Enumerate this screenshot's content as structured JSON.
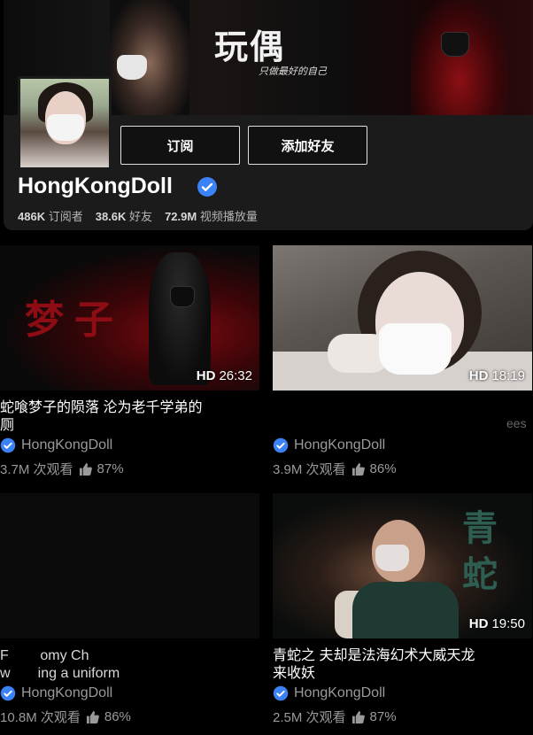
{
  "channel": {
    "banner_title": "玩偶",
    "banner_subtitle": "只做最好的自己",
    "name": "HongKongDoll",
    "subscribe_label": "订阅",
    "add_friend_label": "添加好友",
    "stats": [
      {
        "value": "486K",
        "label": "订阅者"
      },
      {
        "value": "38.6K",
        "label": "好友"
      },
      {
        "value": "72.9M",
        "label": "视频播放量"
      }
    ]
  },
  "videos": [
    {
      "title": "蛇喰梦子的陨落 沦为老千学弟的\n厕",
      "duration_hd": "HD",
      "duration": "26:32",
      "channel": "HongKongDoll",
      "views": "3.7M 次观看",
      "rating": "87%",
      "thumb_text": "梦子"
    },
    {
      "title": "",
      "title_fragment": "ees",
      "duration_hd": "HD",
      "duration": "18:19",
      "channel": "HongKongDoll",
      "views": "3.9M 次观看",
      "rating": "86%"
    },
    {
      "title": "F        omy Ch\nw       ing a uniform",
      "duration_hd": "",
      "duration": "",
      "channel": "HongKongDoll",
      "views": "10.8M 次观看",
      "rating": "86%"
    },
    {
      "title": "青蛇之       夫却是法海幻术大威天龙\n来收妖",
      "duration_hd": "HD",
      "duration": "19:50",
      "channel": "HongKongDoll",
      "views": "2.5M 次观看",
      "rating": "87%",
      "thumb_text": "青\n蛇"
    }
  ],
  "colors": {
    "verified": "#3b82f6",
    "card_bg": "#1b1b1b",
    "meta_text": "#9a9a9a"
  },
  "icons": [
    "verified-check-icon",
    "thumbs-up-icon"
  ]
}
